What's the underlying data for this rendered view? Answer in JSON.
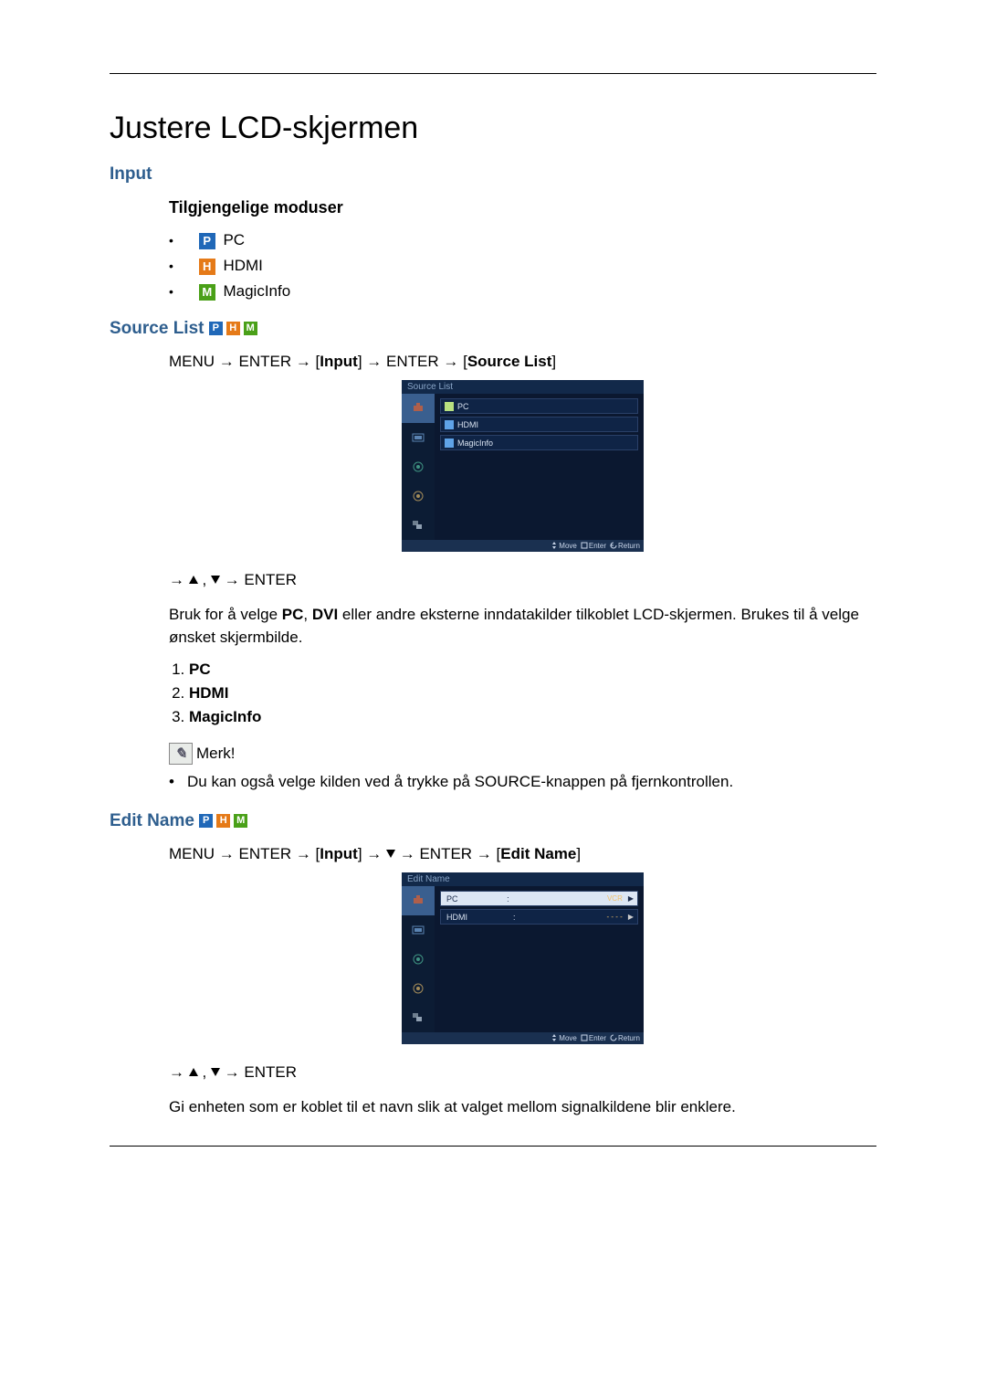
{
  "title": "Justere LCD-skjermen",
  "section_input": "Input",
  "modes_heading": "Tilgjengelige moduser",
  "modes": {
    "pc": {
      "badge": "P",
      "label": "PC"
    },
    "hdmi": {
      "badge": "H",
      "label": "HDMI"
    },
    "magic": {
      "badge": "M",
      "label": "MagicInfo"
    }
  },
  "source_list_heading": "Source List",
  "menu_path1": {
    "p1": "MENU → ENTER → [",
    "bold1": "Input",
    "p2": "] → ENTER → [",
    "bold2": "Source List",
    "p3": "]"
  },
  "osd1": {
    "title": "Source List",
    "rows": [
      {
        "label": "PC",
        "selected": true
      },
      {
        "label": "HDMI",
        "selected": false
      },
      {
        "label": "MagicInfo",
        "selected": false
      }
    ],
    "footer": {
      "move": "Move",
      "enter": "Enter",
      "return": "Return"
    }
  },
  "nav_hint1": "→ ▲ , ▼ → ENTER",
  "desc1_a": "Bruk for å velge ",
  "desc1_b": "PC",
  "desc1_c": ", ",
  "desc1_d": "DVI",
  "desc1_e": " eller andre eksterne inndatakilder tilkoblet LCD-skjermen. Brukes til å velge ønsket skjermbilde.",
  "numlist": [
    "PC",
    "HDMI",
    "MagicInfo"
  ],
  "note_label": "Merk!",
  "note_text": "Du kan også velge kilden ved å trykke på SOURCE-knappen på fjernkontrollen.",
  "edit_name_heading": "Edit Name",
  "menu_path2": {
    "p1": "MENU → ENTER → [",
    "bold1": "Input",
    "p2": "] → ▼ → ENTER → [",
    "bold2": "Edit Name",
    "p3": "]"
  },
  "osd2": {
    "title": "Edit  Name",
    "rows": [
      {
        "label": "PC",
        "value": "VCR"
      },
      {
        "label": "HDMI",
        "value": "- - - -"
      }
    ],
    "footer": {
      "move": "Move",
      "enter": "Enter",
      "return": "Return"
    }
  },
  "nav_hint2": "→ ▲ , ▼ → ENTER",
  "desc2": "Gi enheten som er koblet til et navn slik at valget mellom signalkildene blir enklere."
}
